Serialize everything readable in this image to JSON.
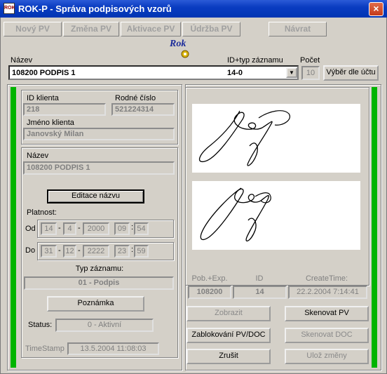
{
  "window": {
    "title": "ROK-P - Správa podpisových vzorů",
    "close": "×"
  },
  "toolbar": [
    "Nový PV",
    "Změna PV",
    "Aktivace PV",
    "Údržba PV",
    "Návrat"
  ],
  "logo": "Rok",
  "header": {
    "nazev_label": "Název",
    "nazev_value": "108200 PODPIS 1",
    "id_label": "ID+typ záznamu",
    "id_value": "14-0",
    "pocet_label": "Počet",
    "pocet_value": "10",
    "vyber_button": "Výběr dle účtu"
  },
  "client": {
    "id_label": "ID klienta",
    "id_value": "218",
    "rc_label": "Rodné číslo",
    "rc_value": "521224314",
    "name_label": "Jméno klienta",
    "name_value": "Janovský Milan"
  },
  "record": {
    "nazev_label": "Název",
    "nazev_value": "108200 PODPIS 1",
    "edit_button": "Editace názvu",
    "platnost_label": "Platnost:",
    "od_label": "Od",
    "od": [
      "14",
      "4",
      "2000",
      "09",
      "54"
    ],
    "do_label": "Do",
    "do": [
      "31",
      "12",
      "2222",
      "23",
      "59"
    ],
    "typ_label": "Typ záznamu:",
    "typ_value": "01 - Podpis",
    "poznamka_button": "Poznámka",
    "status_label": "Status:",
    "status_value": "0 - Aktivní",
    "timestamp_label": "TimeStamp",
    "timestamp_value": "13.5.2004 11:08:03"
  },
  "info": {
    "pob_label": "Pob.+Exp.",
    "pob_value": "108200",
    "id_label": "ID",
    "id_value": "14",
    "ct_label": "CreateTime:",
    "ct_value": "22.2.2004 7:14:41"
  },
  "actions": {
    "zobrazit": "Zobrazit",
    "skenovat_pv": "Skenovat PV",
    "zablokovani": "Zablokování PV/DOC",
    "skenovat_doc": "Skenovat DOC",
    "zrusit": "Zrušit",
    "uloz": "Ulož změny"
  }
}
